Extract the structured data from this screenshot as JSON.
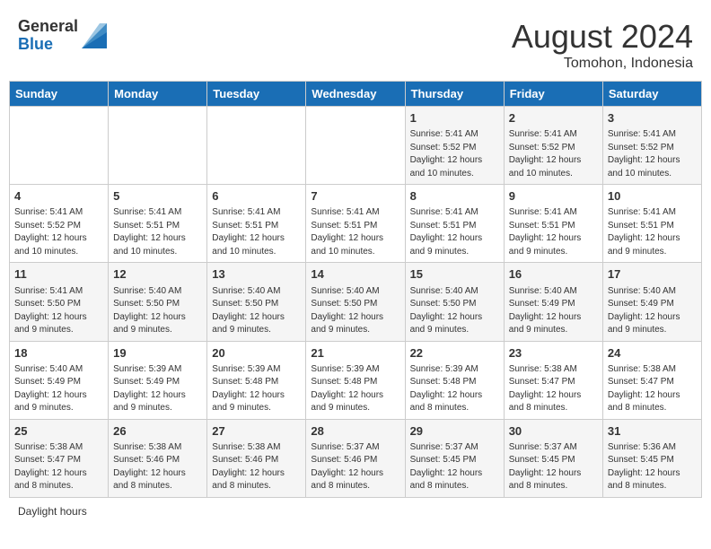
{
  "header": {
    "logo_general": "General",
    "logo_blue": "Blue",
    "month_year": "August 2024",
    "location": "Tomohon, Indonesia"
  },
  "days_of_week": [
    "Sunday",
    "Monday",
    "Tuesday",
    "Wednesday",
    "Thursday",
    "Friday",
    "Saturday"
  ],
  "weeks": [
    [
      {
        "day": "",
        "info": ""
      },
      {
        "day": "",
        "info": ""
      },
      {
        "day": "",
        "info": ""
      },
      {
        "day": "",
        "info": ""
      },
      {
        "day": "1",
        "info": "Sunrise: 5:41 AM\nSunset: 5:52 PM\nDaylight: 12 hours and 10 minutes."
      },
      {
        "day": "2",
        "info": "Sunrise: 5:41 AM\nSunset: 5:52 PM\nDaylight: 12 hours and 10 minutes."
      },
      {
        "day": "3",
        "info": "Sunrise: 5:41 AM\nSunset: 5:52 PM\nDaylight: 12 hours and 10 minutes."
      }
    ],
    [
      {
        "day": "4",
        "info": "Sunrise: 5:41 AM\nSunset: 5:52 PM\nDaylight: 12 hours and 10 minutes."
      },
      {
        "day": "5",
        "info": "Sunrise: 5:41 AM\nSunset: 5:51 PM\nDaylight: 12 hours and 10 minutes."
      },
      {
        "day": "6",
        "info": "Sunrise: 5:41 AM\nSunset: 5:51 PM\nDaylight: 12 hours and 10 minutes."
      },
      {
        "day": "7",
        "info": "Sunrise: 5:41 AM\nSunset: 5:51 PM\nDaylight: 12 hours and 10 minutes."
      },
      {
        "day": "8",
        "info": "Sunrise: 5:41 AM\nSunset: 5:51 PM\nDaylight: 12 hours and 9 minutes."
      },
      {
        "day": "9",
        "info": "Sunrise: 5:41 AM\nSunset: 5:51 PM\nDaylight: 12 hours and 9 minutes."
      },
      {
        "day": "10",
        "info": "Sunrise: 5:41 AM\nSunset: 5:51 PM\nDaylight: 12 hours and 9 minutes."
      }
    ],
    [
      {
        "day": "11",
        "info": "Sunrise: 5:41 AM\nSunset: 5:50 PM\nDaylight: 12 hours and 9 minutes."
      },
      {
        "day": "12",
        "info": "Sunrise: 5:40 AM\nSunset: 5:50 PM\nDaylight: 12 hours and 9 minutes."
      },
      {
        "day": "13",
        "info": "Sunrise: 5:40 AM\nSunset: 5:50 PM\nDaylight: 12 hours and 9 minutes."
      },
      {
        "day": "14",
        "info": "Sunrise: 5:40 AM\nSunset: 5:50 PM\nDaylight: 12 hours and 9 minutes."
      },
      {
        "day": "15",
        "info": "Sunrise: 5:40 AM\nSunset: 5:50 PM\nDaylight: 12 hours and 9 minutes."
      },
      {
        "day": "16",
        "info": "Sunrise: 5:40 AM\nSunset: 5:49 PM\nDaylight: 12 hours and 9 minutes."
      },
      {
        "day": "17",
        "info": "Sunrise: 5:40 AM\nSunset: 5:49 PM\nDaylight: 12 hours and 9 minutes."
      }
    ],
    [
      {
        "day": "18",
        "info": "Sunrise: 5:40 AM\nSunset: 5:49 PM\nDaylight: 12 hours and 9 minutes."
      },
      {
        "day": "19",
        "info": "Sunrise: 5:39 AM\nSunset: 5:49 PM\nDaylight: 12 hours and 9 minutes."
      },
      {
        "day": "20",
        "info": "Sunrise: 5:39 AM\nSunset: 5:48 PM\nDaylight: 12 hours and 9 minutes."
      },
      {
        "day": "21",
        "info": "Sunrise: 5:39 AM\nSunset: 5:48 PM\nDaylight: 12 hours and 9 minutes."
      },
      {
        "day": "22",
        "info": "Sunrise: 5:39 AM\nSunset: 5:48 PM\nDaylight: 12 hours and 8 minutes."
      },
      {
        "day": "23",
        "info": "Sunrise: 5:38 AM\nSunset: 5:47 PM\nDaylight: 12 hours and 8 minutes."
      },
      {
        "day": "24",
        "info": "Sunrise: 5:38 AM\nSunset: 5:47 PM\nDaylight: 12 hours and 8 minutes."
      }
    ],
    [
      {
        "day": "25",
        "info": "Sunrise: 5:38 AM\nSunset: 5:47 PM\nDaylight: 12 hours and 8 minutes."
      },
      {
        "day": "26",
        "info": "Sunrise: 5:38 AM\nSunset: 5:46 PM\nDaylight: 12 hours and 8 minutes."
      },
      {
        "day": "27",
        "info": "Sunrise: 5:38 AM\nSunset: 5:46 PM\nDaylight: 12 hours and 8 minutes."
      },
      {
        "day": "28",
        "info": "Sunrise: 5:37 AM\nSunset: 5:46 PM\nDaylight: 12 hours and 8 minutes."
      },
      {
        "day": "29",
        "info": "Sunrise: 5:37 AM\nSunset: 5:45 PM\nDaylight: 12 hours and 8 minutes."
      },
      {
        "day": "30",
        "info": "Sunrise: 5:37 AM\nSunset: 5:45 PM\nDaylight: 12 hours and 8 minutes."
      },
      {
        "day": "31",
        "info": "Sunrise: 5:36 AM\nSunset: 5:45 PM\nDaylight: 12 hours and 8 minutes."
      }
    ]
  ],
  "legend": {
    "daylight_hours_label": "Daylight hours"
  }
}
